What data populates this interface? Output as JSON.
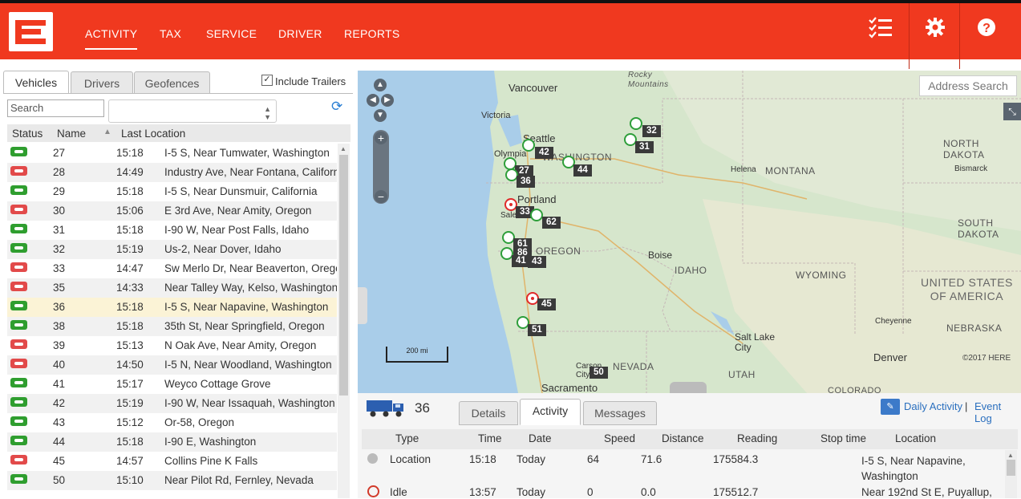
{
  "nav": {
    "activity": "ACTIVITY",
    "tax": "TAX",
    "service": "SERVICE",
    "driver": "DRIVER",
    "reports": "REPORTS"
  },
  "left_tabs": {
    "vehicles": "Vehicles",
    "drivers": "Drivers",
    "geofences": "Geofences"
  },
  "include_trailers": "Include Trailers",
  "search_placeholder": "Search",
  "table": {
    "headers": {
      "status": "Status",
      "name": "Name",
      "last_location": "Last Location"
    },
    "rows": [
      {
        "status": "green",
        "name": "27",
        "time": "15:18",
        "location": "I-5 S, Near Tumwater, Washington"
      },
      {
        "status": "red",
        "name": "28",
        "time": "14:49",
        "location": "Industry Ave, Near Fontana, California"
      },
      {
        "status": "green",
        "name": "29",
        "time": "15:18",
        "location": "I-5 S, Near Dunsmuir, California"
      },
      {
        "status": "red",
        "name": "30",
        "time": "15:06",
        "location": "E 3rd Ave, Near Amity, Oregon"
      },
      {
        "status": "green",
        "name": "31",
        "time": "15:18",
        "location": "I-90 W, Near Post Falls, Idaho"
      },
      {
        "status": "green",
        "name": "32",
        "time": "15:19",
        "location": "Us-2, Near Dover, Idaho"
      },
      {
        "status": "red",
        "name": "33",
        "time": "14:47",
        "location": "Sw Merlo Dr, Near Beaverton, Oregon"
      },
      {
        "status": "red",
        "name": "35",
        "time": "14:33",
        "location": "Near Talley Way, Kelso, Washington"
      },
      {
        "status": "green",
        "name": "36",
        "time": "15:18",
        "location": "I-5 S, Near Napavine, Washington"
      },
      {
        "status": "green",
        "name": "38",
        "time": "15:18",
        "location": "35th St, Near Springfield, Oregon"
      },
      {
        "status": "red",
        "name": "39",
        "time": "15:13",
        "location": "N Oak Ave, Near Amity, Oregon"
      },
      {
        "status": "red",
        "name": "40",
        "time": "14:50",
        "location": "I-5 N, Near Woodland, Washington"
      },
      {
        "status": "green",
        "name": "41",
        "time": "15:17",
        "location": "Weyco Cottage Grove"
      },
      {
        "status": "green",
        "name": "42",
        "time": "15:19",
        "location": "I-90 W, Near Issaquah, Washington"
      },
      {
        "status": "green",
        "name": "43",
        "time": "15:12",
        "location": "Or-58, Oregon"
      },
      {
        "status": "green",
        "name": "44",
        "time": "15:18",
        "location": "I-90 E, Washington"
      },
      {
        "status": "red",
        "name": "45",
        "time": "14:57",
        "location": "Collins Pine K Falls"
      },
      {
        "status": "green",
        "name": "50",
        "time": "15:10",
        "location": "Near Pilot Rd, Fernley, Nevada"
      }
    ]
  },
  "map": {
    "address_search": "Address Search",
    "scale": "200 mi",
    "copyright": "©2017 HERE",
    "labels": {
      "vancouver": "Vancouver",
      "victoria": "Victoria",
      "rocky": "Rocky",
      "mountains": "Mountains",
      "seattle": "Seattle",
      "olympia": "Olympia",
      "washington": "WASHINGTON",
      "helena": "Helena",
      "montana": "MONTANA",
      "bismarck": "Bismarck",
      "north_dakota": "NORTH\nDAKOTA",
      "south_dakota": "SOUTH\nDAKOTA",
      "portland": "Portland",
      "salem": "Salem",
      "oregon": "OREGON",
      "boise": "Boise",
      "idaho": "IDAHO",
      "wyoming": "WYOMING",
      "usa": "UNITED STATES\nOF AMERICA",
      "nebraska": "NEBRASKA",
      "cheyenne": "Cheyenne",
      "salt_lake": "Salt Lake\nCity",
      "denver": "Denver",
      "nevada": "NEVADA",
      "utah": "UTAH",
      "carson": "Carson\nCity",
      "sacramento": "Sacramento",
      "colorado": "COLORADO"
    },
    "vehicle_labels": [
      "32",
      "31",
      "42",
      "44",
      "27",
      "36",
      "33",
      "62",
      "61",
      "86",
      "41",
      "43",
      "45",
      "51",
      "50"
    ]
  },
  "detail": {
    "vehicle": "36",
    "tabs": {
      "details": "Details",
      "activity": "Activity",
      "messages": "Messages"
    },
    "daily_activity": "Daily Activity",
    "event_log": "Event Log",
    "headers": {
      "type": "Type",
      "time": "Time",
      "date": "Date",
      "speed": "Speed",
      "distance": "Distance",
      "reading": "Reading",
      "stop_time": "Stop time",
      "location": "Location"
    },
    "rows": [
      {
        "type": "Location",
        "time": "15:18",
        "date": "Today",
        "speed": "64",
        "distance": "71.6",
        "reading": "175584.3",
        "stop_time": "",
        "location": "I-5 S, Near Napavine, Washington"
      },
      {
        "type": "Idle",
        "time": "13:57",
        "date": "Today",
        "speed": "0",
        "distance": "0.0",
        "reading": "175512.7",
        "stop_time": "",
        "location": "Near 192nd St E, Puyallup,"
      }
    ]
  },
  "colors": {
    "brand": "#f0391f",
    "status_green": "#2f9e2f",
    "status_red": "#e24a4a",
    "link": "#2a6fbe"
  }
}
